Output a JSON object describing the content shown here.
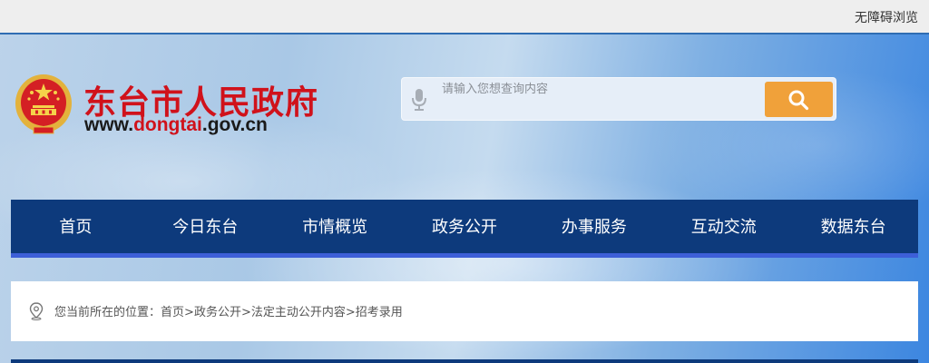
{
  "topbar": {
    "accessibility_label": "无障碍浏览"
  },
  "brand": {
    "title": "东台市人民政府",
    "url_prefix": "www.",
    "url_highlight": "dongtai",
    "url_suffix": ".gov.cn"
  },
  "search": {
    "placeholder": "请输入您想查询内容",
    "value": ""
  },
  "nav": {
    "items": [
      {
        "label": "首页"
      },
      {
        "label": "今日东台"
      },
      {
        "label": "市情概览"
      },
      {
        "label": "政务公开"
      },
      {
        "label": "办事服务"
      },
      {
        "label": "互动交流"
      },
      {
        "label": "数据东台"
      }
    ]
  },
  "breadcrumb": {
    "prefix": "您当前所在的位置：",
    "items": [
      "首页",
      "政务公开",
      "法定主动公开内容",
      "招考录用"
    ],
    "separator": ">"
  },
  "colors": {
    "brand_red": "#d0121b",
    "nav_bg": "#0d3a7c",
    "search_button": "#f0a13a"
  },
  "icons": {
    "emblem": "national-emblem-icon",
    "mic": "microphone-icon",
    "search": "search-icon",
    "location": "location-pin-icon"
  }
}
